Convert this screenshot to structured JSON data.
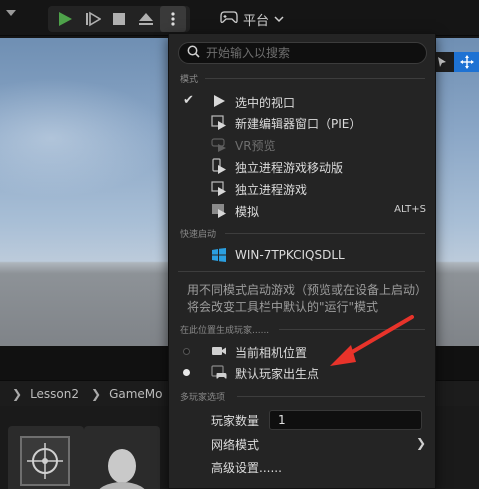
{
  "toolbar": {
    "buttons": [
      {
        "icon": "play-icon"
      },
      {
        "icon": "skip-icon"
      },
      {
        "icon": "stop-icon"
      },
      {
        "icon": "eject-icon"
      },
      {
        "icon": "options-icon"
      }
    ],
    "platform_label": "平台",
    "accent_play": "#4ea24a"
  },
  "menu": {
    "search_placeholder": "开始输入以搜索",
    "section_modes": "模式",
    "modes": [
      {
        "label": "选中的视口",
        "checked": true,
        "enabled": true,
        "icon": "play-triangle-icon"
      },
      {
        "label": "新建编辑器窗口（PIE）",
        "checked": false,
        "enabled": true,
        "icon": "new-window-play-icon"
      },
      {
        "label": "VR预览",
        "checked": false,
        "enabled": false,
        "icon": "vr-play-icon"
      },
      {
        "label": "独立进程游戏移动版",
        "checked": false,
        "enabled": true,
        "icon": "mobile-play-icon"
      },
      {
        "label": "独立进程游戏",
        "checked": false,
        "enabled": true,
        "icon": "standalone-play-icon"
      },
      {
        "label": "模拟",
        "checked": false,
        "enabled": true,
        "icon": "simulate-icon",
        "shortcut": "ALT+S"
      }
    ],
    "section_quick_launch": "快速启动",
    "quick_launch": [
      {
        "label": "WIN-7TPKCIQSDLL",
        "icon": "windows-icon"
      }
    ],
    "description": "用不同模式启动游戏（预览或在设备上启动）将会改变工具栏中默认的\"运行\"模式",
    "section_spawn": "在此位置生成玩家......",
    "spawn_options": [
      {
        "label": "当前相机位置",
        "selected": false,
        "icon": "camera-icon"
      },
      {
        "label": "默认玩家出生点",
        "selected": true,
        "icon": "gamepad-icon"
      }
    ],
    "section_multiplayer": "多玩家选项",
    "player_count_label": "玩家数量",
    "player_count_value": "1",
    "net_mode_label": "网络模式",
    "advanced_label": "高级设置......"
  },
  "content_browser": {
    "breadcrumbs": [
      "Lesson2",
      "GameMo"
    ]
  },
  "annotation_color": "#e8332a"
}
